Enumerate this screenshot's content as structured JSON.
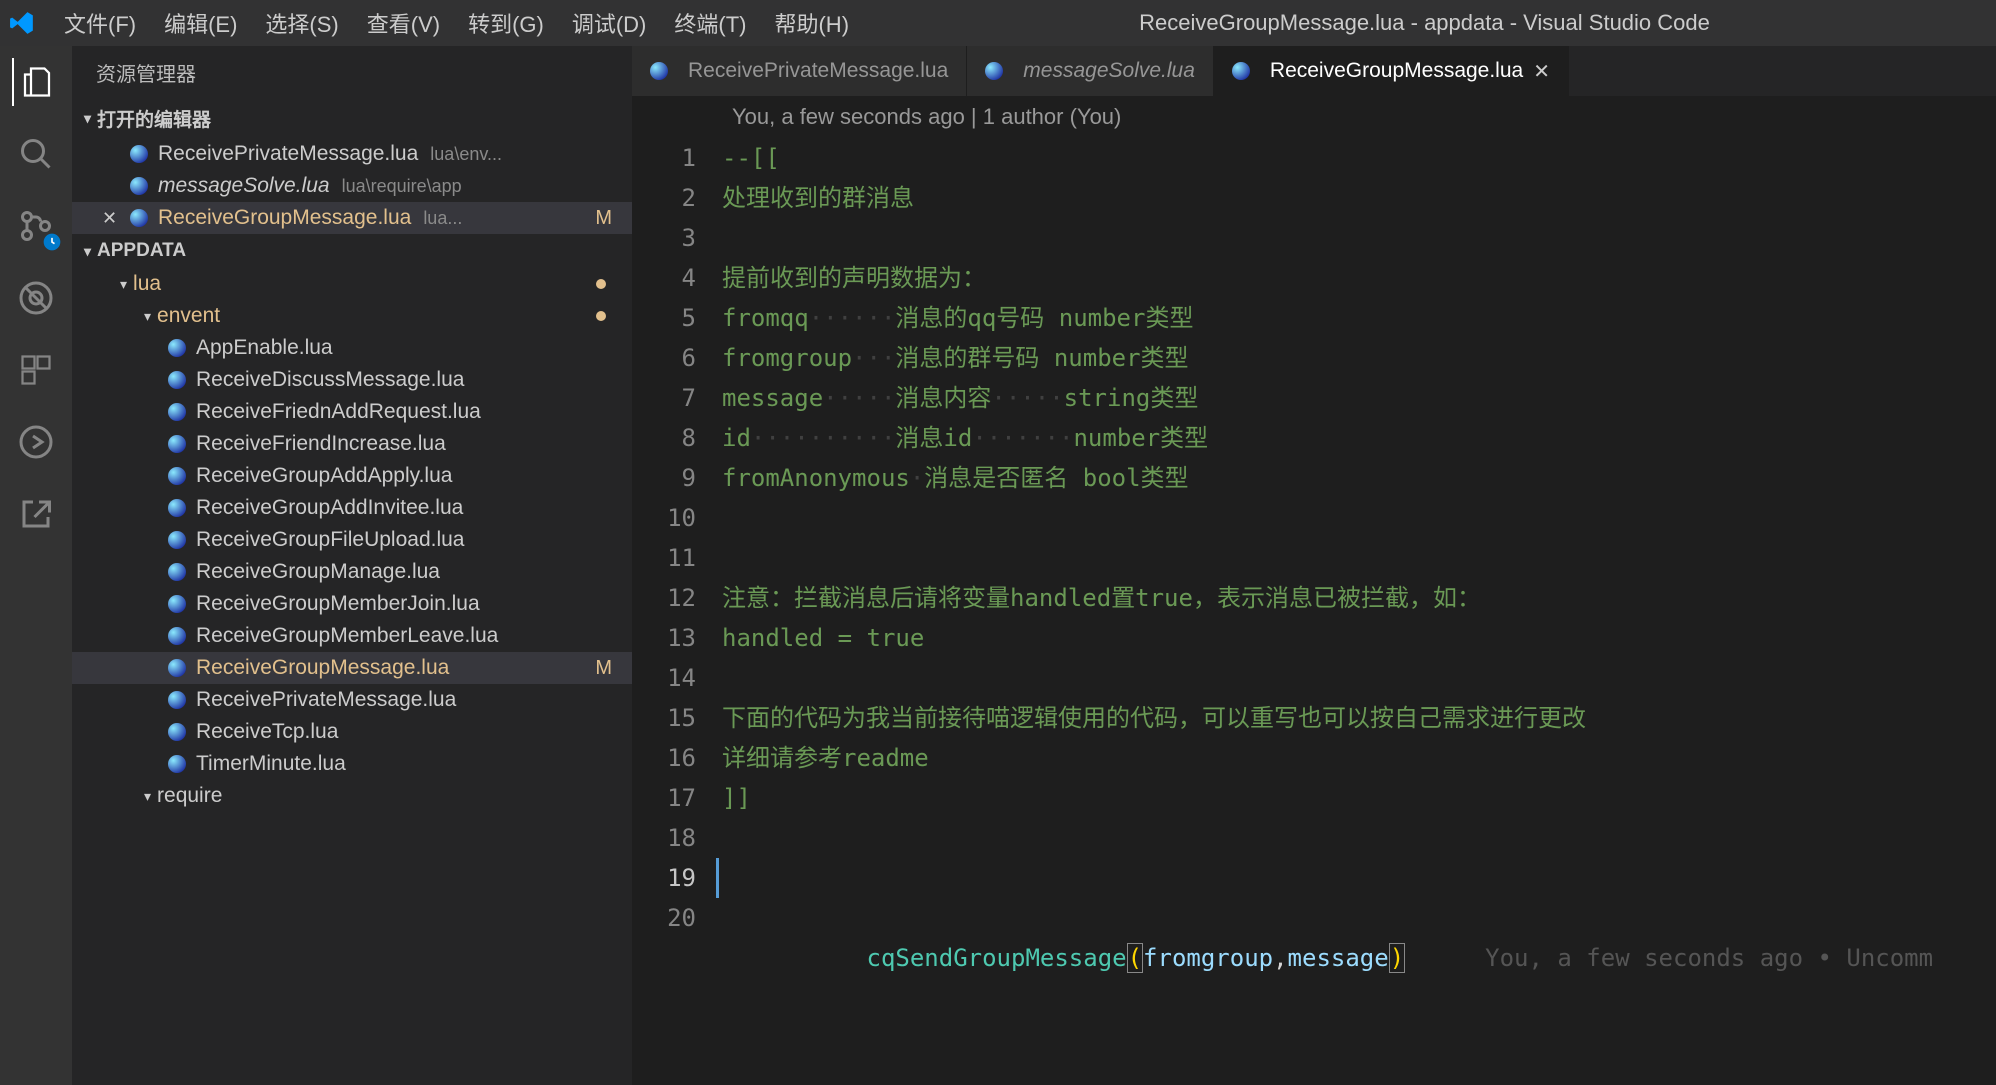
{
  "title": "ReceiveGroupMessage.lua - appdata - Visual Studio Code",
  "menu": [
    "文件(F)",
    "编辑(E)",
    "选择(S)",
    "查看(V)",
    "转到(G)",
    "调试(D)",
    "终端(T)",
    "帮助(H)"
  ],
  "sidebar": {
    "title": "资源管理器",
    "open_editors_label": "打开的编辑器",
    "open_editors": [
      {
        "name": "ReceivePrivateMessage.lua",
        "path": "lua\\env...",
        "modified": false,
        "italic": false
      },
      {
        "name": "messageSolve.lua",
        "path": "lua\\require\\app",
        "modified": false,
        "italic": true
      },
      {
        "name": "ReceiveGroupMessage.lua",
        "path": "lua...",
        "modified": true,
        "italic": false,
        "badge": "M",
        "close_visible": true
      }
    ],
    "project": "APPDATA",
    "folders": [
      {
        "name": "lua",
        "depth": 1,
        "modified": true,
        "dot": true
      },
      {
        "name": "envent",
        "depth": 2,
        "modified": true,
        "dot": true
      }
    ],
    "files": [
      {
        "name": "AppEnable.lua"
      },
      {
        "name": "ReceiveDiscussMessage.lua"
      },
      {
        "name": "ReceiveFriednAddRequest.lua"
      },
      {
        "name": "ReceiveFriendIncrease.lua"
      },
      {
        "name": "ReceiveGroupAddApply.lua"
      },
      {
        "name": "ReceiveGroupAddInvitee.lua"
      },
      {
        "name": "ReceiveGroupFileUpload.lua"
      },
      {
        "name": "ReceiveGroupManage.lua"
      },
      {
        "name": "ReceiveGroupMemberJoin.lua"
      },
      {
        "name": "ReceiveGroupMemberLeave.lua"
      },
      {
        "name": "ReceiveGroupMessage.lua",
        "modified": true,
        "badge": "M",
        "selected": true
      },
      {
        "name": "ReceivePrivateMessage.lua"
      },
      {
        "name": "ReceiveTcp.lua"
      },
      {
        "name": "TimerMinute.lua"
      }
    ],
    "folder_require": "require"
  },
  "tabs": [
    {
      "name": "ReceivePrivateMessage.lua",
      "active": false
    },
    {
      "name": "messageSolve.lua",
      "active": false,
      "italic": true
    },
    {
      "name": "ReceiveGroupMessage.lua",
      "active": true,
      "close": true
    }
  ],
  "codelens": "You, a few seconds ago | 1 author (You)",
  "code": {
    "l1": "--[[",
    "l2": "处理收到的群消息",
    "l4": "提前收到的声明数据为：",
    "l5a": "fromqq",
    "l5b": "消息的qq号码 number类型",
    "l6a": "fromgroup",
    "l6b": "消息的群号码 number类型",
    "l7a": "message",
    "l7b": "消息内容",
    "l7c": "string类型",
    "l8a": "id",
    "l8b": "消息id",
    "l8c": "number类型",
    "l9a": "fromAnonymous",
    "l9b": "消息是否匿名 bool类型",
    "l12": "注意：拦截消息后请将变量handled置true，表示消息已被拦截，如：",
    "l13": "handled = true",
    "l15": "下面的代码为我当前接待喵逻辑使用的代码，可以重写也可以按自己需求进行更改",
    "l16": "详细请参考readme",
    "l17": "]]",
    "l19_func": "cqSendGroupMessage",
    "l19_a1": "fromgroup",
    "l19_a2": "message",
    "inline_hint": "You, a few seconds ago • Uncomm"
  },
  "line_numbers": [
    "1",
    "2",
    "3",
    "4",
    "5",
    "6",
    "7",
    "8",
    "9",
    "10",
    "11",
    "12",
    "13",
    "14",
    "15",
    "16",
    "17",
    "18",
    "19",
    "20"
  ]
}
